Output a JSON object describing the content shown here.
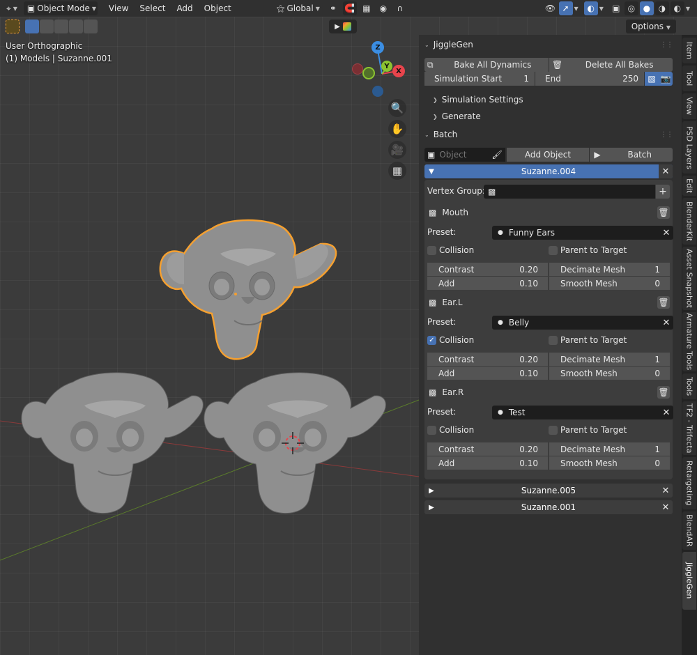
{
  "header": {
    "mode_label": "Object Mode",
    "menus": [
      "View",
      "Select",
      "Add",
      "Object"
    ],
    "transform_orientation": "Global",
    "options_label": "Options"
  },
  "viewport": {
    "view_name": "User Orthographic",
    "collection_info": "(1) Models | Suzanne.001",
    "gizmo_axes": {
      "z": "Z",
      "y": "Y",
      "x": "X"
    }
  },
  "jigglegen": {
    "title": "JiggleGen",
    "bake_all_label": "Bake All Dynamics",
    "delete_all_label": "Delete All Bakes",
    "sim_start_label": "Simulation Start",
    "sim_start_value": "1",
    "end_label": "End",
    "end_value": "250",
    "simulation_settings_label": "Simulation Settings",
    "generate_label": "Generate"
  },
  "batch": {
    "title": "Batch",
    "object_placeholder": "Object",
    "add_object_label": "Add Object",
    "batch_label": "Batch",
    "active_item": "Suzanne.004",
    "vertex_group_label": "Vertex Group:",
    "preset_label": "Preset:",
    "collision_label": "Collision",
    "parent_label": "Parent to Target",
    "modifiers": [
      {
        "name": "Mouth",
        "preset": "Funny Ears",
        "collision": false,
        "contrast_label": "Contrast",
        "contrast": "0.20",
        "decimate_label": "Decimate Mesh",
        "decimate": "1",
        "add_label": "Add",
        "add": "0.10",
        "smooth_label": "Smooth Mesh",
        "smooth": "0"
      },
      {
        "name": "Ear.L",
        "preset": "Belly",
        "collision": true,
        "contrast_label": "Contrast",
        "contrast": "0.20",
        "decimate_label": "Decimate Mesh",
        "decimate": "1",
        "add_label": "Add",
        "add": "0.10",
        "smooth_label": "Smooth Mesh",
        "smooth": "0"
      },
      {
        "name": "Ear.R",
        "preset": "Test",
        "collision": false,
        "contrast_label": "Contrast",
        "contrast": "0.20",
        "decimate_label": "Decimate Mesh",
        "decimate": "1",
        "add_label": "Add",
        "add": "0.10",
        "smooth_label": "Smooth Mesh",
        "smooth": "0"
      }
    ],
    "collapsed_items": [
      "Suzanne.005",
      "Suzanne.001"
    ]
  },
  "tabs": [
    "Item",
    "Tool",
    "View",
    "PSD Layers",
    "Edit",
    "BlenderKit",
    "Asset Snapshot",
    "Armature Tools",
    "Tools",
    "TF2 - Trifecta",
    "Retargeting",
    "BlendAR",
    "JiggleGen"
  ],
  "colors": {
    "accent": "#4772b3",
    "selection_outline": "#f5a030",
    "axis_x": "#e8444c",
    "axis_y": "#8cc431",
    "axis_z": "#3b8ee3"
  }
}
